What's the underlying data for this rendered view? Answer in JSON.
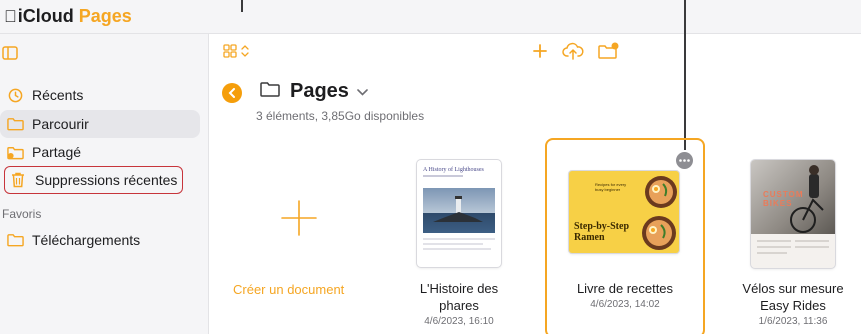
{
  "app": {
    "brand_icloud": "iCloud",
    "brand_pages": "Pages",
    "accent": "#f5a623",
    "danger": "#c7343b"
  },
  "sidebar": {
    "items": [
      {
        "label": "Récents",
        "icon": "clock-icon"
      },
      {
        "label": "Parcourir",
        "icon": "folder-icon",
        "selected": true
      },
      {
        "label": "Partagé",
        "icon": "shared-folder-icon"
      },
      {
        "label": "Suppressions récentes",
        "icon": "trash-icon",
        "highlighted": true
      }
    ],
    "section_favorites": "Favoris",
    "favorites": [
      {
        "label": "Téléchargements",
        "icon": "folder-icon"
      }
    ]
  },
  "toolbar": {
    "view_icon": "grid-view-icon",
    "add_icon": "plus-icon",
    "upload_icon": "cloud-upload-icon",
    "new_folder_icon": "new-folder-icon"
  },
  "folder": {
    "title": "Pages",
    "info": "3 éléments, 3,85Go disponibles"
  },
  "documents": {
    "create_label": "Créer un document",
    "items": [
      {
        "name_line1": "L'Histoire des",
        "name_line2": "phares",
        "date": "4/6/2023, 16:10",
        "thumb_title": "A History of Lighthouses"
      },
      {
        "name_line1": "Livre de recettes",
        "name_line2": "",
        "date": "4/6/2023, 14:02",
        "thumb_title": "Step-by-Step Ramen",
        "thumb_kicker": "Recipes for every busy beginner",
        "selected": true
      },
      {
        "name_line1": "Vélos sur mesure",
        "name_line2": "Easy Rides",
        "date": "1/6/2023, 11:36",
        "thumb_title": "CUSTOM BIKES"
      }
    ]
  }
}
